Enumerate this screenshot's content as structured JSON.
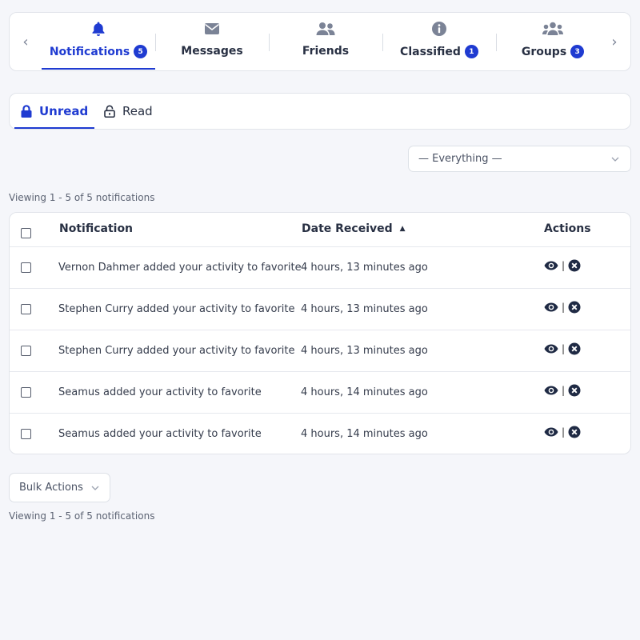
{
  "nav": {
    "tabs": [
      {
        "label": "Notifications",
        "badge": "5",
        "icon": "bell-icon",
        "active": true
      },
      {
        "label": "Messages",
        "badge": "",
        "icon": "envelope-icon",
        "active": false
      },
      {
        "label": "Friends",
        "badge": "",
        "icon": "user-friends-icon",
        "active": false
      },
      {
        "label": "Classified",
        "badge": "1",
        "icon": "info-circle-icon",
        "active": false
      },
      {
        "label": "Groups",
        "badge": "3",
        "icon": "users-icon",
        "active": false
      }
    ],
    "prev_arrow": "‹",
    "next_arrow": "›"
  },
  "subtabs": {
    "unread": "Unread",
    "read": "Read"
  },
  "filter": {
    "selected": "— Everything —"
  },
  "viewing_text": "Viewing 1 - 5 of 5 notifications",
  "table": {
    "columns": {
      "notification": "Notification",
      "date": "Date Received",
      "actions": "Actions"
    },
    "sort_indicator": "▲",
    "rows": [
      {
        "text": "Vernon Dahmer added your activity to favorite",
        "date": "4 hours, 13 minutes ago"
      },
      {
        "text": "Stephen Curry added your activity to favorite",
        "date": "4 hours, 13 minutes ago"
      },
      {
        "text": "Stephen Curry added your activity to favorite",
        "date": "4 hours, 13 minutes ago"
      },
      {
        "text": "Seamus added your activity to favorite",
        "date": "4 hours, 14 minutes ago"
      },
      {
        "text": "Seamus added your activity to favorite",
        "date": "4 hours, 14 minutes ago"
      }
    ],
    "action_separator": "|"
  },
  "bulk": {
    "label": "Bulk Actions"
  },
  "colors": {
    "accent": "#1f3bd1",
    "icon_gray": "#7b8396",
    "text_dark": "#283043",
    "background": "#f5f6fa"
  }
}
